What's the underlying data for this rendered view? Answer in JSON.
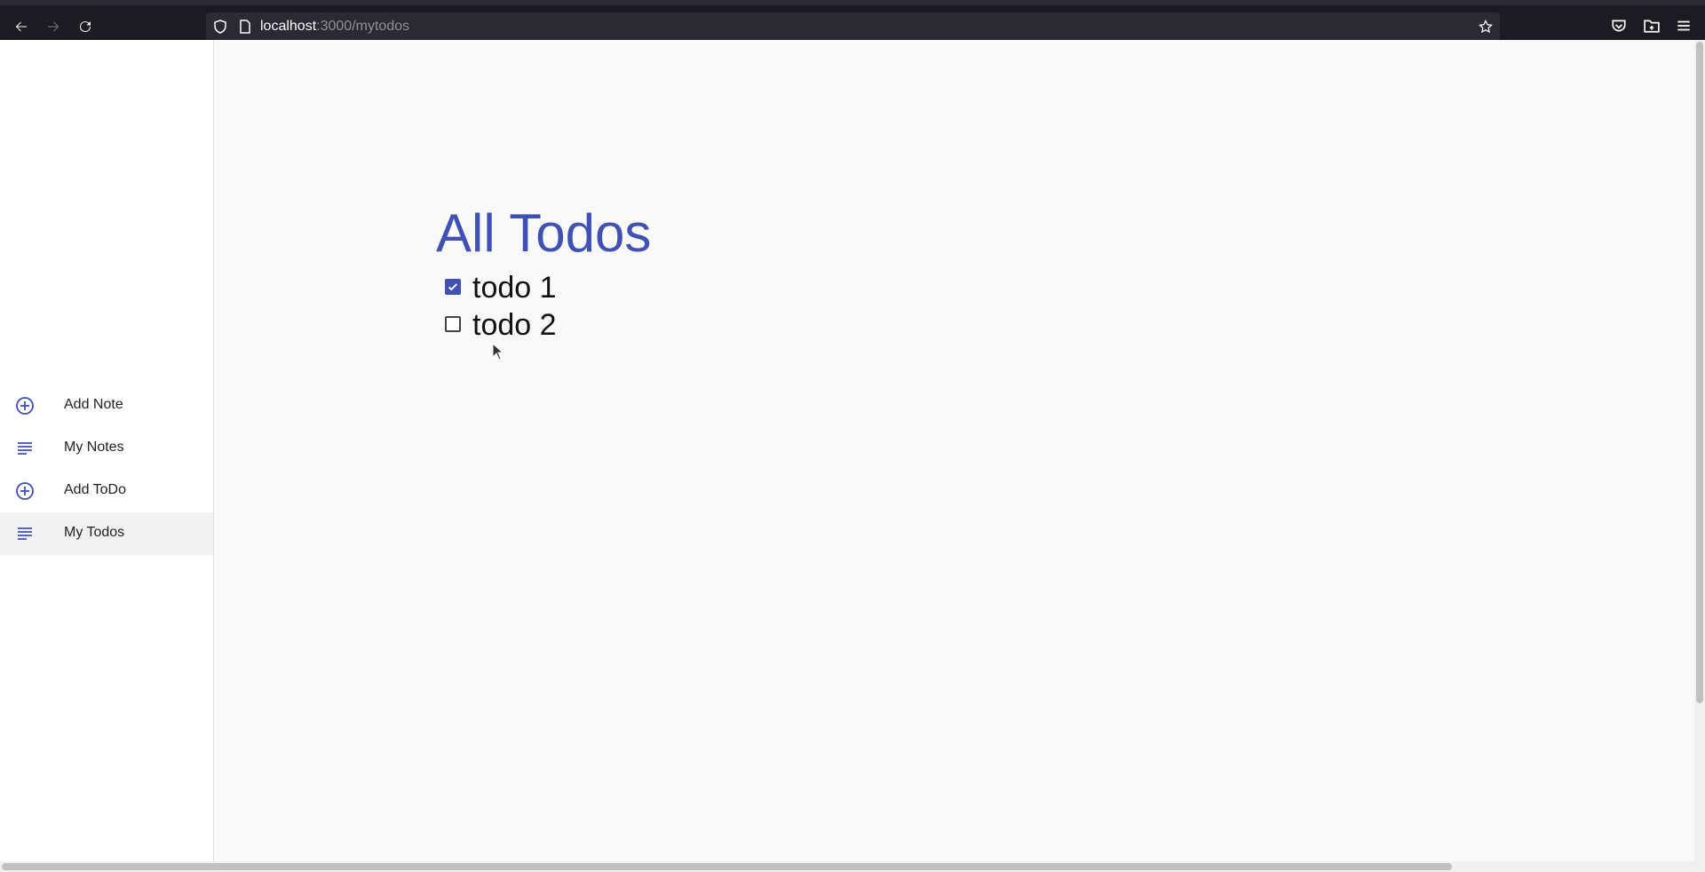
{
  "browser": {
    "url_host": "localhost",
    "url_path": ":3000/mytodos"
  },
  "sidebar": {
    "items": [
      {
        "label": "Add Note",
        "icon": "add-circle-icon",
        "active": false
      },
      {
        "label": "My Notes",
        "icon": "subject-lines-icon",
        "active": false
      },
      {
        "label": "Add ToDo",
        "icon": "add-circle-icon",
        "active": false
      },
      {
        "label": "My Todos",
        "icon": "subject-lines-icon",
        "active": true
      }
    ]
  },
  "main": {
    "title": "All Todos",
    "todos": [
      {
        "text": "todo 1",
        "done": true
      },
      {
        "text": "todo 2",
        "done": false
      }
    ]
  },
  "colors": {
    "accent": "#3f51b5",
    "chrome": "#1c1b22",
    "urlbar": "#2b2a33"
  }
}
